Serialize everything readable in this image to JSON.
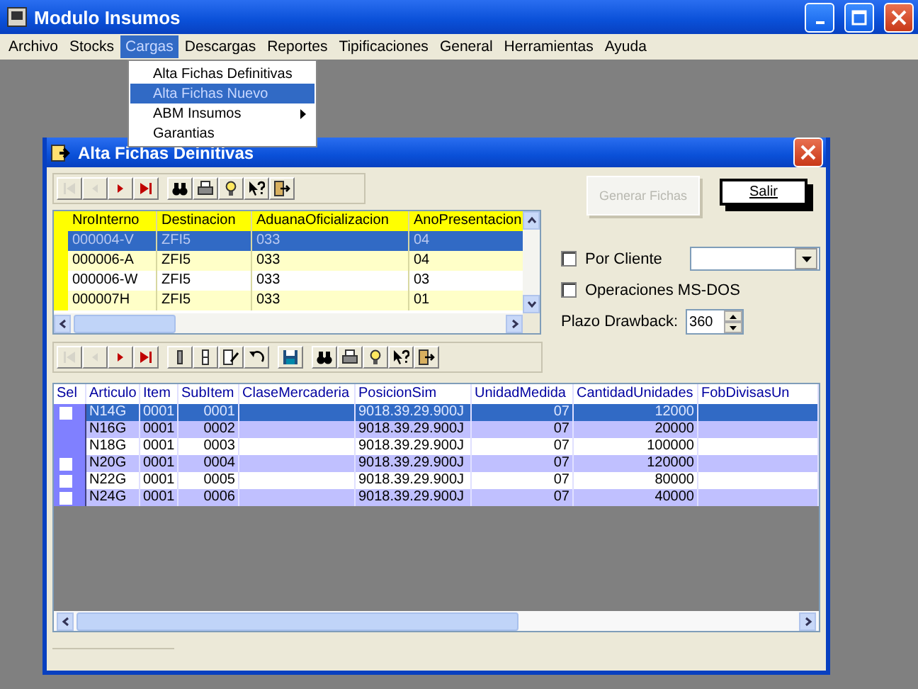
{
  "window": {
    "title": "Modulo Insumos"
  },
  "menu_bar": [
    {
      "label": "Archivo",
      "selected": false
    },
    {
      "label": "Stocks",
      "selected": false
    },
    {
      "label": "Cargas",
      "selected": true
    },
    {
      "label": "Descargas",
      "selected": false
    },
    {
      "label": "Reportes",
      "selected": false
    },
    {
      "label": "Tipificaciones",
      "selected": false
    },
    {
      "label": "General",
      "selected": false
    },
    {
      "label": "Herramientas",
      "selected": false
    },
    {
      "label": "Ayuda",
      "selected": false
    }
  ],
  "dropdown": [
    {
      "label": "Alta Fichas Definitivas",
      "selected": false,
      "submenu": false
    },
    {
      "label": "Alta Fichas Nuevo",
      "selected": true,
      "submenu": false
    },
    {
      "label": "ABM Insumos",
      "selected": false,
      "submenu": true
    },
    {
      "label": "Garantias",
      "selected": false,
      "submenu": false
    }
  ],
  "child_window": {
    "title": "Alta Fichas Deinitivas",
    "toolbar_1": [
      [
        {
          "kind": "first",
          "disabled": true
        },
        {
          "kind": "prev",
          "disabled": true
        },
        {
          "kind": "next",
          "disabled": false
        },
        {
          "kind": "last",
          "disabled": false
        }
      ],
      [
        {
          "kind": "find",
          "disabled": false
        },
        {
          "kind": "print",
          "disabled": false
        },
        {
          "kind": "hint",
          "disabled": false
        },
        {
          "kind": "help",
          "disabled": false
        },
        {
          "kind": "exit",
          "disabled": false
        }
      ]
    ],
    "grid_1": {
      "columns": [
        "NroInterno",
        "Destinacion",
        "AduanaOficializacion",
        "AnoPresentacion"
      ],
      "rows": [
        {
          "cells": [
            "000004-V",
            "ZFI5",
            "033",
            "04"
          ],
          "selected": true
        },
        {
          "cells": [
            "000006-A",
            "ZFI5",
            "033",
            "04"
          ],
          "selected": false
        },
        {
          "cells": [
            "000006-W",
            "ZFI5",
            "033",
            "03"
          ],
          "selected": false
        },
        {
          "cells": [
            "000007H",
            "ZFI5",
            "033",
            "01"
          ],
          "selected": false
        }
      ]
    },
    "generate_button": {
      "label": "Generar Fichas",
      "disabled": true
    },
    "exit_button": {
      "label": "Salir"
    },
    "options": [
      {
        "label": "Por Cliente",
        "checked": false,
        "kind": "combo"
      },
      {
        "label": "Operaciones MS-DOS",
        "checked": false,
        "kind": "plain"
      }
    ],
    "plazo": {
      "label": "Plazo Drawback:",
      "value": "360"
    },
    "toolbar_2": [
      [
        {
          "kind": "first",
          "disabled": true
        },
        {
          "kind": "prev",
          "disabled": true
        },
        {
          "kind": "next",
          "disabled": false
        },
        {
          "kind": "last",
          "disabled": false
        }
      ],
      [
        {
          "kind": "delete",
          "disabled": false
        },
        {
          "kind": "copy",
          "disabled": false
        },
        {
          "kind": "edit",
          "disabled": false
        },
        {
          "kind": "undo",
          "disabled": false
        }
      ],
      [
        {
          "kind": "save",
          "disabled": false
        }
      ],
      [
        {
          "kind": "find",
          "disabled": false
        },
        {
          "kind": "print",
          "disabled": false
        },
        {
          "kind": "hint",
          "disabled": false
        },
        {
          "kind": "help",
          "disabled": false
        },
        {
          "kind": "exit",
          "disabled": false
        }
      ]
    ],
    "grid_2": {
      "columns": [
        "Sel",
        "Articulo",
        "Item",
        "SubItem",
        "ClaseMercaderia",
        "PosicionSim",
        "UnidadMedida",
        "CantidadUnidades",
        "FobDivisasUn"
      ],
      "rows": [
        {
          "checked": false,
          "selected": true,
          "cells": [
            "",
            "N14G",
            "0001",
            "0001",
            "",
            "9018.39.29.900J",
            "07",
            "12000",
            ""
          ]
        },
        {
          "selected": false,
          "cells": [
            "",
            "N16G",
            "0001",
            "0002",
            "",
            "9018.39.29.900J",
            "07",
            "20000",
            ""
          ]
        },
        {
          "selected": false,
          "cells": [
            "",
            "N18G",
            "0001",
            "0003",
            "",
            "9018.39.29.900J",
            "07",
            "100000",
            ""
          ]
        },
        {
          "checked": false,
          "selected": false,
          "cells": [
            "",
            "N20G",
            "0001",
            "0004",
            "",
            "9018.39.29.900J",
            "07",
            "120000",
            ""
          ]
        },
        {
          "checked": false,
          "selected": false,
          "cells": [
            "",
            "N22G",
            "0001",
            "0005",
            "",
            "9018.39.29.900J",
            "07",
            "80000",
            ""
          ]
        },
        {
          "checked": false,
          "selected": false,
          "cells": [
            "",
            "N24G",
            "0001",
            "0006",
            "",
            "9018.39.29.900J",
            "07",
            "40000",
            ""
          ]
        }
      ]
    }
  }
}
